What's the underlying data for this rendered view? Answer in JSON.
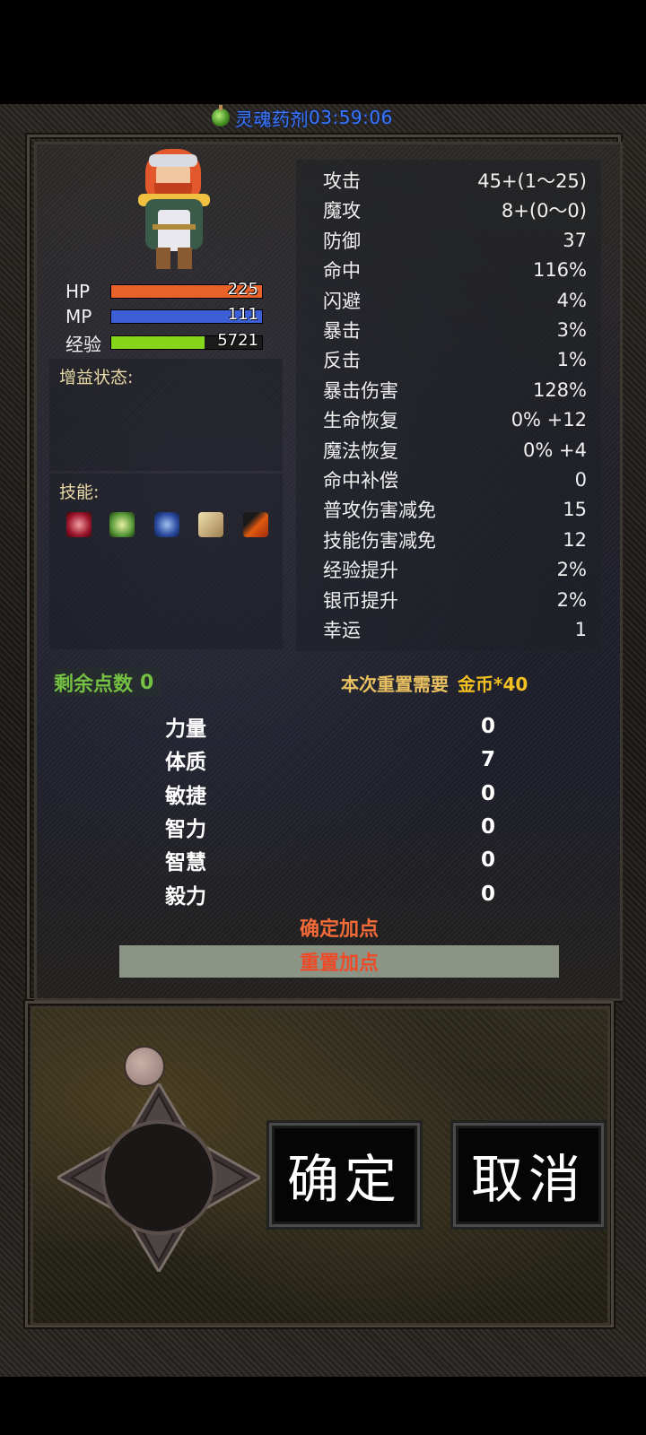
{
  "buff": {
    "label": "灵魂药剂",
    "timer": "03:59:06"
  },
  "character": {
    "hp": {
      "label": "HP",
      "value": "225",
      "fill": 1.0,
      "color": "#e9622a"
    },
    "mp": {
      "label": "MP",
      "value": "111",
      "fill": 1.0,
      "color": "#3d5fd6"
    },
    "exp": {
      "label": "经验",
      "value": "5721",
      "fill": 0.62,
      "color": "#86d61c"
    }
  },
  "buffs_section": {
    "title": "增益状态:"
  },
  "skills_section": {
    "title": "技能:",
    "icons": [
      "fist-skill-icon",
      "wind-skill-icon",
      "shield-skill-icon",
      "scroll-skill-icon",
      "slash-skill-icon"
    ]
  },
  "stats": [
    {
      "name": "攻击",
      "value": "45+(1～25)"
    },
    {
      "name": "魔攻",
      "value": "8+(0～0)"
    },
    {
      "name": "防御",
      "value": "37"
    },
    {
      "name": "命中",
      "value": "116%"
    },
    {
      "name": "闪避",
      "value": "4%"
    },
    {
      "name": "暴击",
      "value": "3%"
    },
    {
      "name": "反击",
      "value": "1%"
    },
    {
      "name": "暴击伤害",
      "value": "128%"
    },
    {
      "name": "生命恢复",
      "value": "0% +12"
    },
    {
      "name": "魔法恢复",
      "value": "0% +4"
    },
    {
      "name": "命中补偿",
      "value": "0"
    },
    {
      "name": "普攻伤害减免",
      "value": "15"
    },
    {
      "name": "技能伤害减免",
      "value": "12"
    },
    {
      "name": "经验提升",
      "value": "2%"
    },
    {
      "name": "银币提升",
      "value": "2%"
    },
    {
      "name": "幸运",
      "value": "1"
    }
  ],
  "points": {
    "label": "剩余点数",
    "value": "0"
  },
  "reset_cost": {
    "label": "本次重置需要",
    "cost": "金币*40"
  },
  "attributes": [
    {
      "name": "力量",
      "value": "0"
    },
    {
      "name": "体质",
      "value": "7"
    },
    {
      "name": "敏捷",
      "value": "0"
    },
    {
      "name": "智力",
      "value": "0"
    },
    {
      "name": "智慧",
      "value": "0"
    },
    {
      "name": "毅力",
      "value": "0"
    }
  ],
  "actions": {
    "confirm_points": "确定加点",
    "reset_points": "重置加点",
    "ok": "确定",
    "cancel": "取消"
  }
}
